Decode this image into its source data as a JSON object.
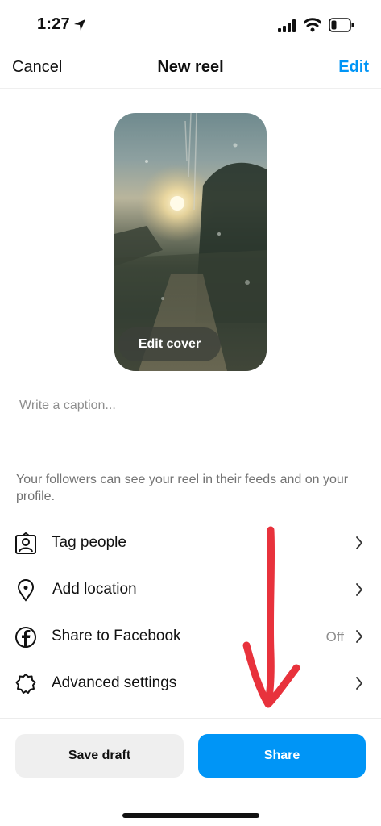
{
  "status_bar": {
    "time": "1:27",
    "icons": [
      "location-arrow-icon",
      "cellular-signal-icon",
      "wifi-icon",
      "battery-low-icon"
    ]
  },
  "nav": {
    "cancel_label": "Cancel",
    "title": "New reel",
    "edit_label": "Edit"
  },
  "cover": {
    "edit_cover_label": "Edit cover"
  },
  "caption": {
    "placeholder": "Write a caption..."
  },
  "info_text": "Your followers can see your reel in their feeds and on your profile.",
  "options": [
    {
      "label": "Tag people",
      "icon": "tag-person-icon"
    },
    {
      "label": "Add location",
      "icon": "location-pin-icon"
    },
    {
      "label": "Share to Facebook",
      "icon": "facebook-icon",
      "state": "Off"
    },
    {
      "label": "Advanced settings",
      "icon": "settings-gear-icon"
    }
  ],
  "buttons": {
    "save_draft_label": "Save draft",
    "share_label": "Share"
  },
  "colors": {
    "accent": "#0095f6",
    "annotation_arrow": "#e8323c"
  }
}
